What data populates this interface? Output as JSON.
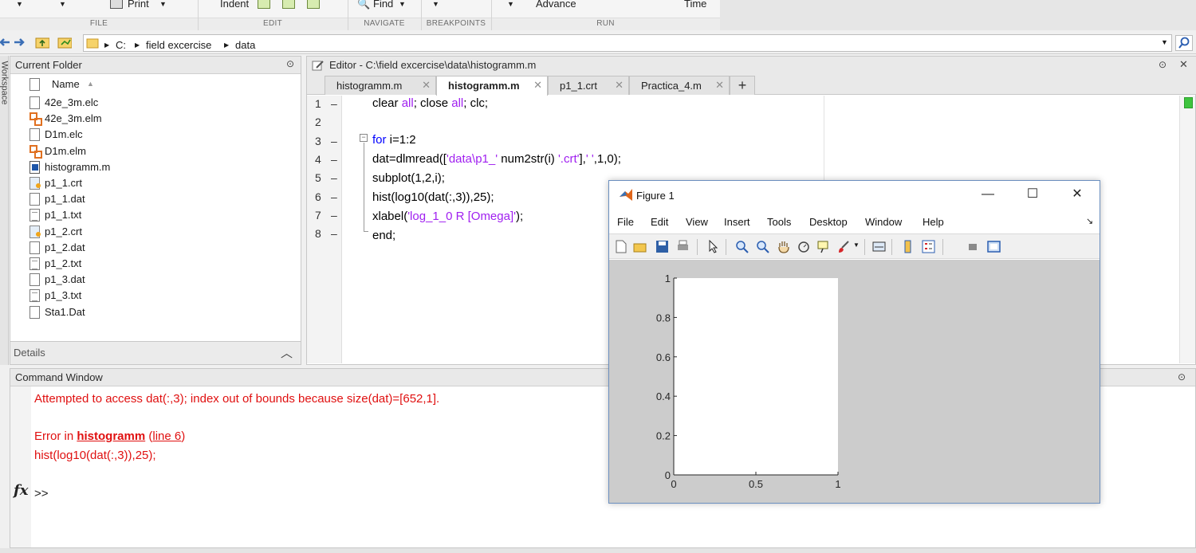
{
  "toolstrip": {
    "items": {
      "print": "Print",
      "indent": "Indent",
      "find": "Find",
      "advance": "Advance",
      "time": "Time"
    },
    "sections": {
      "file": "FILE",
      "edit": "EDIT",
      "navigate": "NAVIGATE",
      "breakpoints": "BREAKPOINTS",
      "run": "RUN"
    }
  },
  "address_bar": {
    "segments": [
      "C:",
      "field excercise",
      "data"
    ]
  },
  "workspace_tab_label": "Workspace",
  "current_folder": {
    "title": "Current Folder",
    "column_name": "Name",
    "sort_indicator": "▲",
    "files": [
      {
        "name": "42e_3m.elc",
        "icon": "document-icon"
      },
      {
        "name": "42e_3m.elm",
        "icon": "simulink-model-icon"
      },
      {
        "name": "D1m.elc",
        "icon": "document-icon"
      },
      {
        "name": "D1m.elm",
        "icon": "simulink-model-icon"
      },
      {
        "name": "histogramm.m",
        "icon": "matlab-script-icon"
      },
      {
        "name": "p1_1.crt",
        "icon": "certificate-icon"
      },
      {
        "name": "p1_1.dat",
        "icon": "document-icon"
      },
      {
        "name": "p1_1.txt",
        "icon": "text-file-icon"
      },
      {
        "name": "p1_2.crt",
        "icon": "certificate-icon"
      },
      {
        "name": "p1_2.dat",
        "icon": "document-icon"
      },
      {
        "name": "p1_2.txt",
        "icon": "text-file-icon"
      },
      {
        "name": "p1_3.dat",
        "icon": "document-icon"
      },
      {
        "name": "p1_3.txt",
        "icon": "text-file-icon"
      },
      {
        "name": "Sta1.Dat",
        "icon": "document-icon"
      }
    ],
    "details_label": "Details"
  },
  "editor": {
    "title": "Editor - C:\\field excercise\\data\\histogramm.m",
    "tabs": [
      {
        "label": "histogramm.m",
        "active": false
      },
      {
        "label": "histogramm.m",
        "active": true
      },
      {
        "label": "p1_1.crt",
        "active": false
      },
      {
        "label": "Practica_4.m",
        "active": false
      }
    ],
    "add_tab": "+",
    "lines": [
      {
        "num": "1",
        "dash": "–"
      },
      {
        "num": "2",
        "dash": ""
      },
      {
        "num": "3",
        "dash": "–"
      },
      {
        "num": "4",
        "dash": "–"
      },
      {
        "num": "5",
        "dash": "–"
      },
      {
        "num": "6",
        "dash": "–"
      },
      {
        "num": "7",
        "dash": "–"
      },
      {
        "num": "8",
        "dash": "–"
      }
    ],
    "code": {
      "l1_a": "clear ",
      "l1_b": "all",
      "l1_c": "; close ",
      "l1_d": "all",
      "l1_e": "; clc;",
      "l3_a": "for",
      "l3_b": " i=1:2",
      "l4_a": "dat=dlmread([",
      "l4_b": "'data\\p1_'",
      "l4_c": " num2str(i) ",
      "l4_d": "'.crt'",
      "l4_e": "],",
      "l4_f": "' '",
      "l4_g": ",1,0);",
      "l5": "subplot(1,2,i);",
      "l6": "hist(log10(dat(:,3)),25);",
      "l7_a": "xlabel(",
      "l7_b": "'log_1_0 R [Omega]'",
      "l7_c": ");",
      "l8": "end;"
    }
  },
  "command_window": {
    "title": "Command Window",
    "error_line1": "Attempted to access dat(:,3); index out of bounds because size(dat)=[652,1].",
    "error_in": "Error in ",
    "error_func": "histogramm",
    "error_line_link": "line 6",
    "error_paren_open": " (",
    "error_paren_close": ")",
    "error_code": "hist(log10(dat(:,3)),25);",
    "fx": "fx",
    "prompt": ">>"
  },
  "figure": {
    "title": "Figure 1",
    "menus": [
      "File",
      "Edit",
      "View",
      "Insert",
      "Tools",
      "Desktop",
      "Window",
      "Help"
    ],
    "menu_arrow": "↘",
    "window_buttons": {
      "minimize": "—",
      "maximize": "☐",
      "close": "✕"
    }
  },
  "chart_data": {
    "type": "bar",
    "title": "",
    "xlabel": "",
    "ylabel": "",
    "xlim": [
      0,
      1
    ],
    "ylim": [
      0,
      1
    ],
    "xticks": [
      "0",
      "0.5",
      "1"
    ],
    "yticks": [
      "0",
      "0.2",
      "0.4",
      "0.6",
      "0.8",
      "1"
    ],
    "series": [],
    "grid": false
  },
  "colors": {
    "error_text": "#e01010",
    "keyword": "#0000ff",
    "string": "#a020f0",
    "figure_background": "#cccccc"
  }
}
